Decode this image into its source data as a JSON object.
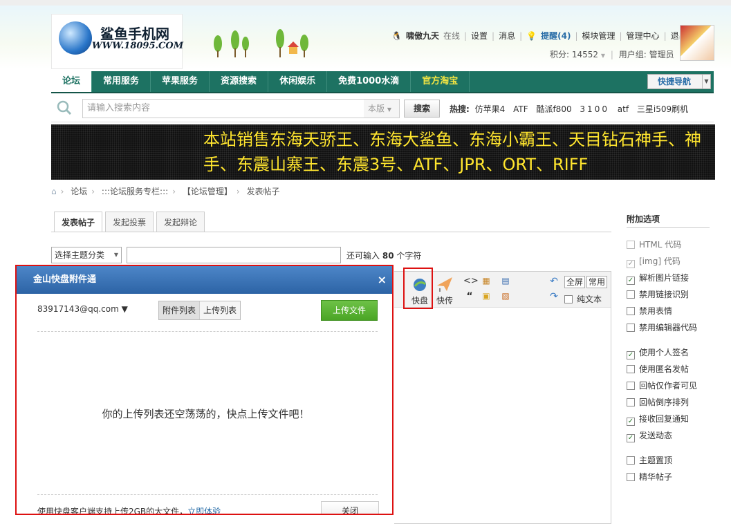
{
  "logo": {
    "name": "鲨鱼手机网",
    "url": "WWW.18095.COM"
  },
  "user": {
    "name": "啸傲九天",
    "status": "在线",
    "links": [
      "设置",
      "消息"
    ],
    "remind": "提醒(4)",
    "links2": [
      "模块管理",
      "管理中心",
      "退出"
    ],
    "points": "积分: 14552",
    "group": "用户组: 管理员"
  },
  "nav": {
    "items": [
      "论坛",
      "常用服务",
      "苹果服务",
      "资源搜索",
      "休闲娱乐",
      "免费1000水滴",
      "官方淘宝"
    ],
    "quick": "快捷导航"
  },
  "search": {
    "placeholder": "请输入搜索内容",
    "type": "本版",
    "button": "搜索",
    "hot_label": "热搜:",
    "hot": [
      "仿苹果4",
      "ATF",
      "酷派f800",
      "3100",
      "atf",
      "三星i509刷机"
    ]
  },
  "banner": {
    "text": "本站销售东海天骄王、东海大鲨鱼、东海小霸王、天目钻石神手、神手、东震山寨王、东震3号、ATF、JPR、ORT、RIFF"
  },
  "breadcrumb": [
    "论坛",
    ":::论坛服务专栏:::",
    "【论坛管理】",
    "发表帖子"
  ],
  "tabs": [
    "发表帖子",
    "发起投票",
    "发起辩论"
  ],
  "subject": {
    "category": "选择主题分类",
    "remain_prefix": "还可输入",
    "remain_count": "80",
    "remain_suffix": "个字符"
  },
  "toolbar": {
    "kuaipan": "快盘",
    "kuaichuan": "快传",
    "fullscreen": "全屏",
    "common": "常用",
    "plaintext": "纯文本"
  },
  "sidebar": {
    "title": "附加选项",
    "group1": [
      {
        "label": "HTML 代码",
        "checked": false,
        "disabled": true
      },
      {
        "label": "[img] 代码",
        "checked": true,
        "disabled": true
      },
      {
        "label": "解析图片链接",
        "checked": true,
        "disabled": false
      },
      {
        "label": "禁用链接识别",
        "checked": false,
        "disabled": false
      },
      {
        "label": "禁用表情",
        "checked": false,
        "disabled": false
      },
      {
        "label": "禁用编辑器代码",
        "checked": false,
        "disabled": false
      }
    ],
    "group2": [
      {
        "label": "使用个人签名",
        "checked": true
      },
      {
        "label": "使用匿名发帖",
        "checked": false
      },
      {
        "label": "回帖仅作者可见",
        "checked": false
      },
      {
        "label": "回帖倒序排列",
        "checked": false
      },
      {
        "label": "接收回复通知",
        "checked": true
      },
      {
        "label": "发送动态",
        "checked": true
      }
    ],
    "group3": [
      {
        "label": "主题置顶",
        "checked": false
      },
      {
        "label": "精华帖子",
        "checked": false
      }
    ]
  },
  "dialog": {
    "title": "金山快盘附件通",
    "account": "83917143@qq.com ▼",
    "seg": [
      "附件列表",
      "上传列表"
    ],
    "upload": "上传文件",
    "empty": "你的上传列表还空荡荡的，快点上传文件吧！",
    "tip": "使用快盘客户端支持上传2GB的大文件，",
    "tip_link": "立即体验",
    "close": "关闭"
  },
  "colors": {
    "nav": "#1d7262",
    "accent_red": "#dd1111",
    "dialog_header": "#3a72b6",
    "upload_green": "#4aa525"
  }
}
